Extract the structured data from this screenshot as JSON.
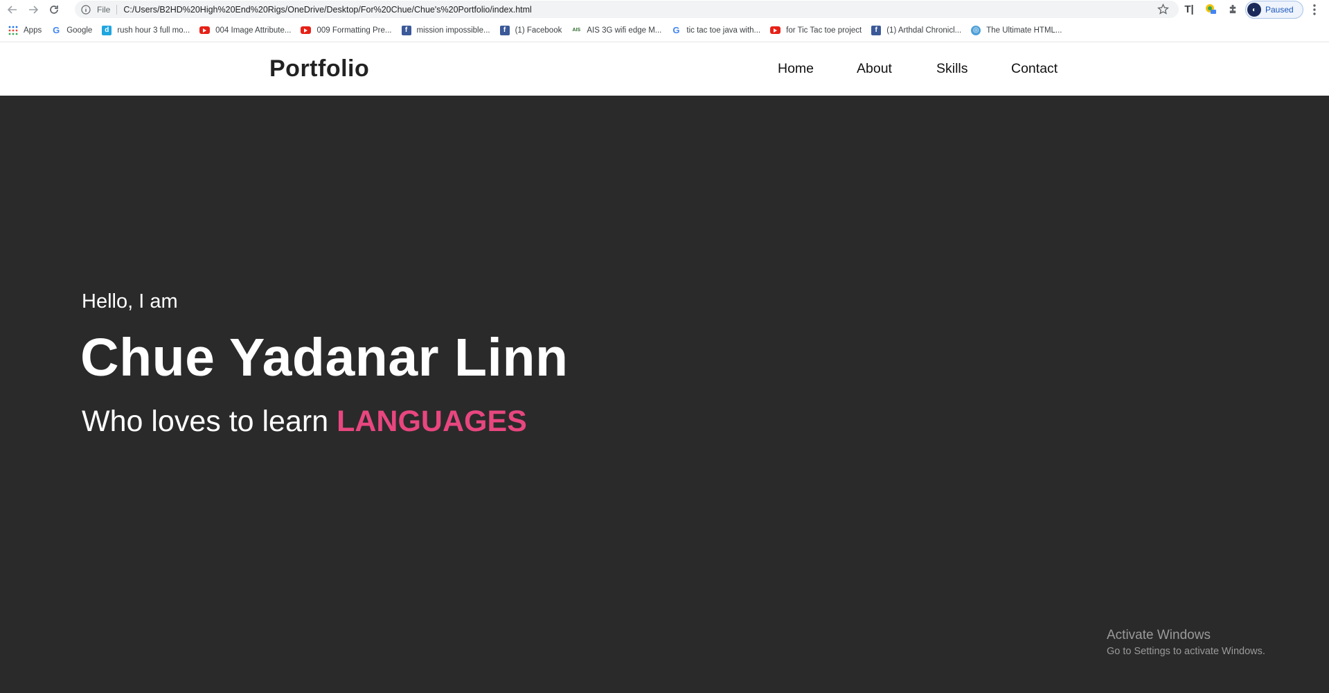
{
  "browser": {
    "url_scheme": "File",
    "url": "C:/Users/B2HD%20High%20End%20Rigs/OneDrive/Desktop/For%20Chue/Chue's%20Portfolio/index.html",
    "profile_status": "Paused",
    "icons": [
      "back-icon",
      "forward-icon",
      "reload-icon",
      "info-icon",
      "star-icon",
      "extensions-icon",
      "menu-icon"
    ]
  },
  "bookmarks": [
    {
      "label": "Apps",
      "icon": "apps-grid-icon"
    },
    {
      "label": "Google",
      "icon": "google-icon"
    },
    {
      "label": "rush hour 3 full mo...",
      "icon": "d-icon"
    },
    {
      "label": "004 Image Attribute...",
      "icon": "youtube-icon"
    },
    {
      "label": "009 Formatting Pre...",
      "icon": "youtube-icon"
    },
    {
      "label": "mission impossible...",
      "icon": "facebook-icon"
    },
    {
      "label": "(1) Facebook",
      "icon": "facebook-icon"
    },
    {
      "label": "AIS 3G wifi edge M...",
      "icon": "ais-icon"
    },
    {
      "label": "tic tac toe java with...",
      "icon": "google-icon"
    },
    {
      "label": "for Tic Tac toe project",
      "icon": "youtube-icon"
    },
    {
      "label": "(1) Arthdal Chronicl...",
      "icon": "facebook-icon"
    },
    {
      "label": "The Ultimate HTML...",
      "icon": "html-icon"
    }
  ],
  "site": {
    "brand": "Portfolio",
    "nav": [
      "Home",
      "About",
      "Skills",
      "Contact"
    ]
  },
  "hero": {
    "greeting": "Hello, I am",
    "name": "Chue Yadanar Linn",
    "tagline_prefix": "Who loves to learn",
    "tagline_highlight": "LANGUAGES",
    "highlight_color": "#e8467f"
  },
  "watermark": {
    "title": "Activate Windows",
    "subtitle": "Go to Settings to activate Windows."
  }
}
